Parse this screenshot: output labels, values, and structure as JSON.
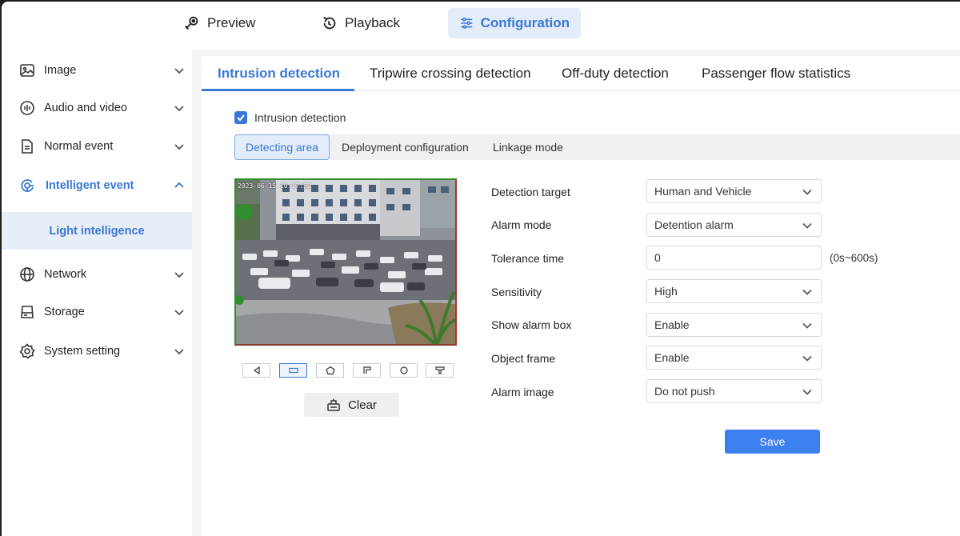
{
  "topnav": {
    "items": [
      {
        "label": "Preview",
        "icon": "preview-icon"
      },
      {
        "label": "Playback",
        "icon": "playback-icon"
      },
      {
        "label": "Configuration",
        "icon": "configuration-icon",
        "active": true
      }
    ]
  },
  "sidebar": {
    "items": [
      {
        "label": "Image",
        "icon": "image-icon"
      },
      {
        "label": "Audio and video",
        "icon": "audio-video-icon"
      },
      {
        "label": "Normal event",
        "icon": "document-icon"
      },
      {
        "label": "Intelligent event",
        "icon": "intelligent-event-icon",
        "expanded": true
      },
      {
        "label": "Network",
        "icon": "globe-icon"
      },
      {
        "label": "Storage",
        "icon": "storage-icon"
      },
      {
        "label": "System setting",
        "icon": "gear-icon"
      }
    ],
    "subitem": {
      "label": "Light intelligence"
    }
  },
  "tabs": [
    {
      "label": "Intrusion detection",
      "active": true
    },
    {
      "label": "Tripwire crossing detection"
    },
    {
      "label": "Off-duty detection"
    },
    {
      "label": "Passenger flow statistics"
    }
  ],
  "enable_checkbox": {
    "label": "Intrusion detection",
    "checked": true
  },
  "subtabs": [
    {
      "label": "Detecting area",
      "active": true
    },
    {
      "label": "Deployment configuration"
    },
    {
      "label": "Linkage mode"
    }
  ],
  "video": {
    "timestamp": "2023-06-15 10:17:52"
  },
  "draw_tools": [
    "back-icon",
    "rectangle-icon",
    "pentagon-icon",
    "polyline-icon",
    "circle-icon",
    "tripwire-icon"
  ],
  "clear_label": "Clear",
  "form": {
    "detection_target": {
      "label": "Detection target",
      "value": "Human and Vehicle"
    },
    "alarm_mode": {
      "label": "Alarm mode",
      "value": "Detention alarm"
    },
    "tolerance_time": {
      "label": "Tolerance time",
      "value": "0",
      "hint": "(0s~600s)"
    },
    "sensitivity": {
      "label": "Sensitivity",
      "value": "High"
    },
    "show_alarm_box": {
      "label": "Show alarm box",
      "value": "Enable"
    },
    "object_frame": {
      "label": "Object frame",
      "value": "Enable"
    },
    "alarm_image": {
      "label": "Alarm image",
      "value": "Do not push"
    }
  },
  "save_label": "Save",
  "colors": {
    "accent": "#3a78d6",
    "save": "#3b7ff0",
    "active_bg": "#e3ecf9"
  }
}
